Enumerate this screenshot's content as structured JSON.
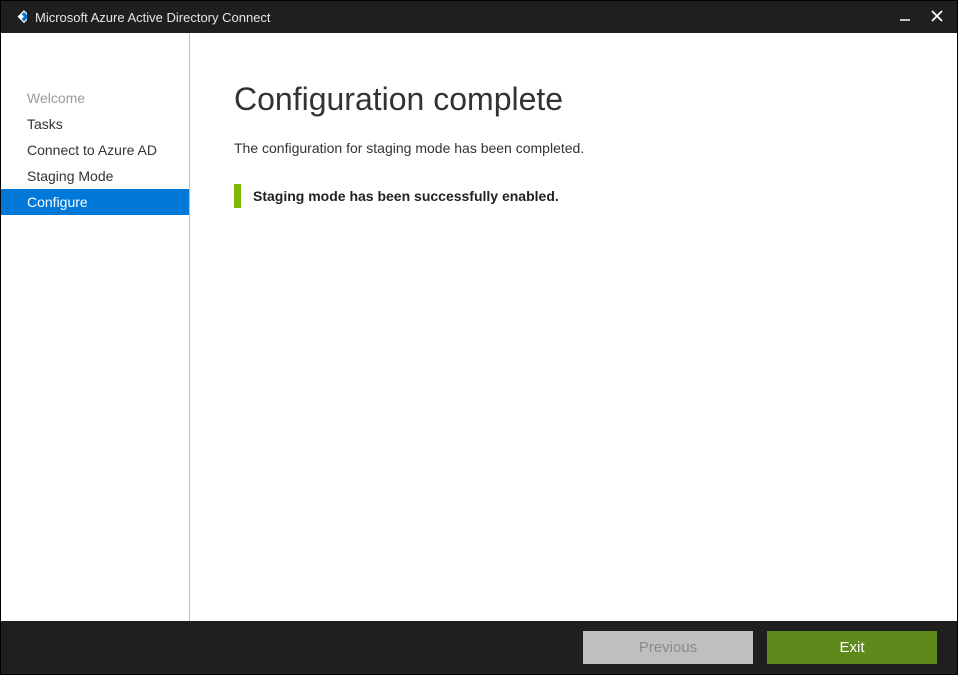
{
  "titlebar": {
    "title": "Microsoft Azure Active Directory Connect"
  },
  "sidebar": {
    "items": [
      {
        "label": "Welcome",
        "state": "disabled"
      },
      {
        "label": "Tasks",
        "state": "normal"
      },
      {
        "label": "Connect to Azure AD",
        "state": "normal"
      },
      {
        "label": "Staging Mode",
        "state": "normal"
      },
      {
        "label": "Configure",
        "state": "active"
      }
    ]
  },
  "main": {
    "title": "Configuration complete",
    "subtitle": "The configuration for staging mode has been completed.",
    "status_message": "Staging mode has been successfully enabled."
  },
  "footer": {
    "previous_label": "Previous",
    "exit_label": "Exit"
  },
  "colors": {
    "accent": "#0078d7",
    "success": "#7fba00",
    "exit_button": "#5e8a1c",
    "titlebar": "#1f1f1f"
  }
}
